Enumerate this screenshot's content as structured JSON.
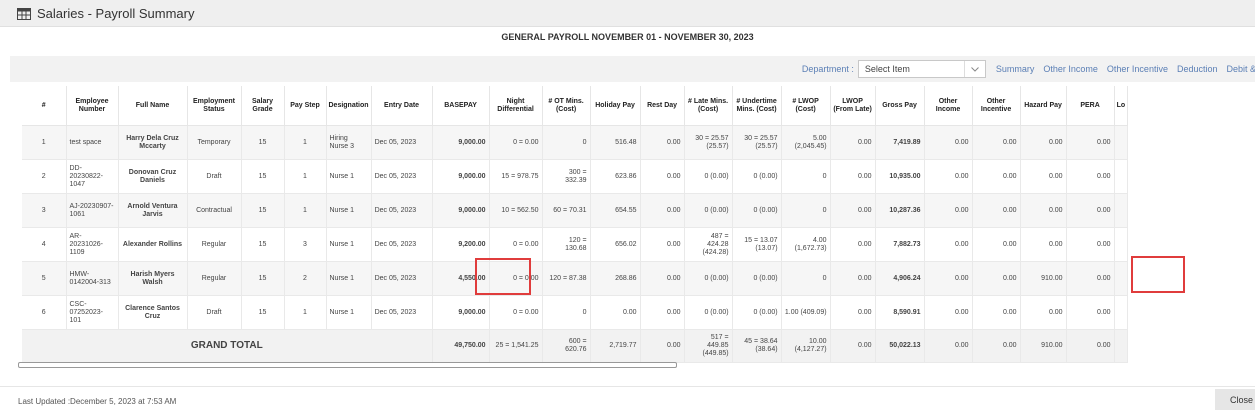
{
  "window": {
    "title": "Salaries - Payroll Summary"
  },
  "report": {
    "title": "GENERAL PAYROLL NOVEMBER 01 - NOVEMBER 30, 2023"
  },
  "filter": {
    "department_label": "Department :",
    "department_value": "Select Item",
    "tabs": [
      "Summary",
      "Other Income",
      "Other Incentive",
      "Deduction",
      "Debit &"
    ]
  },
  "table": {
    "headers": [
      "#",
      "Employee Number",
      "Full Name",
      "Employment Status",
      "Salary Grade",
      "Pay Step",
      "Designation",
      "Entry Date",
      "BASEPAY",
      "Night Differential",
      "# OT Mins. (Cost)",
      "Holiday Pay",
      "Rest Day",
      "# Late Mins. (Cost)",
      "# Undertime Mins. (Cost)",
      "# LWOP (Cost)",
      "LWOP (From Late)",
      "Gross Pay",
      "Other Income",
      "Other Incentive",
      "Hazard Pay",
      "PERA",
      "Lo"
    ],
    "rows": [
      [
        "1",
        "test space",
        "Harry Dela Cruz Mccarty",
        "Temporary",
        "15",
        "1",
        "Hiring Nurse 3",
        "Dec 05, 2023",
        "9,000.00",
        "0 = 0.00",
        "0",
        "516.48",
        "0.00",
        "30 = 25.57 (25.57)",
        "30 = 25.57 (25.57)",
        "5.00 (2,045.45)",
        "0.00",
        "7,419.89",
        "0.00",
        "0.00",
        "0.00",
        "0.00",
        ""
      ],
      [
        "2",
        "DD-20230822-1047",
        "Donovan Cruz Daniels",
        "Draft",
        "15",
        "1",
        "Nurse 1",
        "Dec 05, 2023",
        "9,000.00",
        "15 = 978.75",
        "300 = 332.39",
        "623.86",
        "0.00",
        "0 (0.00)",
        "0 (0.00)",
        "0",
        "0.00",
        "10,935.00",
        "0.00",
        "0.00",
        "0.00",
        "0.00",
        ""
      ],
      [
        "3",
        "AJ-20230907-1061",
        "Arnold Ventura Jarvis",
        "Contractual",
        "15",
        "1",
        "Nurse 1",
        "Dec 05, 2023",
        "9,000.00",
        "10 = 562.50",
        "60 = 70.31",
        "654.55",
        "0.00",
        "0 (0.00)",
        "0 (0.00)",
        "0",
        "0.00",
        "10,287.36",
        "0.00",
        "0.00",
        "0.00",
        "0.00",
        ""
      ],
      [
        "4",
        "AR-20231026-1109",
        "Alexander Rollins",
        "Regular",
        "15",
        "3",
        "Nurse 1",
        "Dec 05, 2023",
        "9,200.00",
        "0 = 0.00",
        "120 = 130.68",
        "656.02",
        "0.00",
        "487 = 424.28 (424.28)",
        "15 = 13.07 (13.07)",
        "4.00 (1,672.73)",
        "0.00",
        "7,882.73",
        "0.00",
        "0.00",
        "0.00",
        "0.00",
        ""
      ],
      [
        "5",
        "HMW-0142004-313",
        "Harish Myers Walsh",
        "Regular",
        "15",
        "2",
        "Nurse 1",
        "Dec 05, 2023",
        "4,550.00",
        "0 = 0.00",
        "120 = 87.38",
        "268.86",
        "0.00",
        "0 (0.00)",
        "0 (0.00)",
        "0",
        "0.00",
        "4,906.24",
        "0.00",
        "0.00",
        "910.00",
        "0.00",
        ""
      ],
      [
        "6",
        "CSC-07252023-101",
        "Clarence Santos Cruz",
        "Draft",
        "15",
        "1",
        "Nurse 1",
        "Dec 05, 2023",
        "9,000.00",
        "0 = 0.00",
        "0",
        "0.00",
        "0.00",
        "0 (0.00)",
        "0 (0.00)",
        "1.00 (409.09)",
        "0.00",
        "8,590.91",
        "0.00",
        "0.00",
        "0.00",
        "0.00",
        ""
      ]
    ],
    "total": {
      "label": "GRAND TOTAL",
      "cells": [
        "49,750.00",
        "25 = 1,541.25",
        "600 = 620.76",
        "2,719.77",
        "0.00",
        "517 = 449.85 (449.85)",
        "45 = 38.64 (38.64)",
        "10.00 (4,127.27)",
        "0.00",
        "50,022.13",
        "0.00",
        "0.00",
        "910.00",
        "0.00",
        ""
      ]
    }
  },
  "footer": {
    "last_updated": "Last Updated :December 5, 2023 at 7:53 AM",
    "close_label": "Close"
  },
  "colors": {
    "link": "#5b7fb5",
    "highlight": "#e03c3c"
  }
}
